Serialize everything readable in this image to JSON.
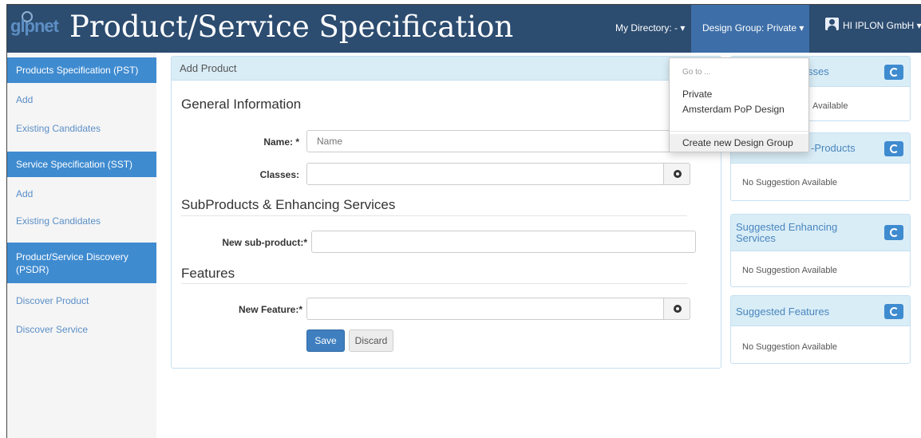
{
  "header": {
    "logo": "glpnet",
    "title": "Product/Service Specification",
    "my_directory": "My Directory: - ▾",
    "design_group": "Design Group: Private ▾",
    "user": "HI IPLON GmbH ▾"
  },
  "sidebar": {
    "sections": [
      {
        "title": "Products Specification (PST)",
        "links": [
          "Add",
          "Existing Candidates"
        ]
      },
      {
        "title": "Service Specification (SST)",
        "links": [
          "Add",
          "Existing Candidates"
        ]
      },
      {
        "title": "Product/Service Discovery (PSDR)",
        "links": [
          "Discover Product",
          "Discover Service"
        ]
      }
    ]
  },
  "main": {
    "panel_title": "Add Product",
    "general_title": "General Information",
    "name_label": "Name: *",
    "name_placeholder": "Name",
    "classes_label": "Classes:",
    "subproducts_title": "SubProducts & Enhancing Services",
    "subproduct_label": "New sub-product:*",
    "features_title": "Features",
    "feature_label": "New Feature:*",
    "save_label": "Save",
    "discard_label": "Discard"
  },
  "suggestions": [
    {
      "title": "Suggested Classes",
      "visible_title": "sses",
      "body": "Available"
    },
    {
      "title": "Suggested Sub-Products",
      "visible_title": "-Products",
      "body": "No Suggestion Available"
    },
    {
      "title": "Suggested Enhancing Services",
      "visible_title": "Suggested Enhancing Services",
      "body": "No Suggestion Available"
    },
    {
      "title": "Suggested Features",
      "visible_title": "Suggested Features",
      "body": "No Suggestion Available"
    }
  ],
  "dropdown": {
    "header": "Go to ...",
    "items": [
      "Private",
      "Amsterdam PoP Design"
    ],
    "create": "Create new Design Group"
  },
  "colors": {
    "topbar": "#2c4c70",
    "active_nav": "#3d6ea8",
    "sidebar_heading": "#3f8bd0",
    "panel_heading": "#d9edf7",
    "primary_button": "#3f7fbf"
  },
  "icons": [
    "user-icon",
    "plus-circle-icon",
    "refresh-icon"
  ]
}
